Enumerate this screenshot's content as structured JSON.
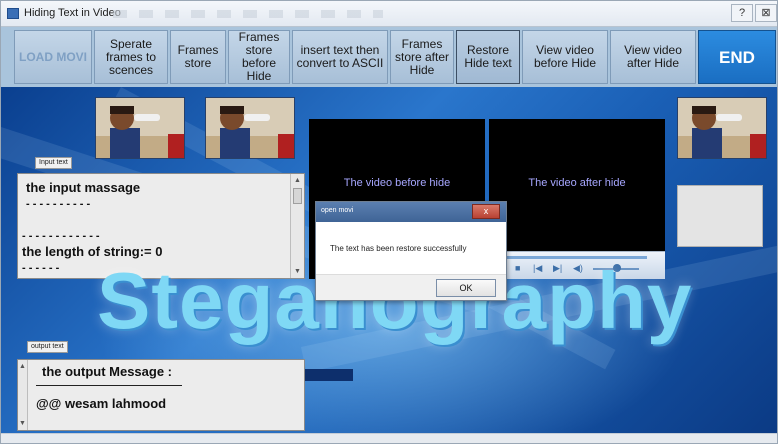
{
  "window": {
    "title": "Hiding Text in Video",
    "controls": {
      "help": "?",
      "close": "⊠"
    }
  },
  "toolbar": {
    "buttons": [
      {
        "label": "LOAD MOVI",
        "state": "disabled"
      },
      {
        "label": "Sperate frames to scences"
      },
      {
        "label": "Frames store"
      },
      {
        "label": "Frames store before Hide"
      },
      {
        "label": "insert text then convert to ASCII"
      },
      {
        "label": "Frames store after Hide"
      },
      {
        "label": "Restore Hide text",
        "state": "pressed"
      },
      {
        "label": "View video before Hide"
      },
      {
        "label": "View video after Hide"
      },
      {
        "label": "END"
      }
    ]
  },
  "input_panel": {
    "label": "Input text",
    "heading": "the input massage",
    "dashes_1": "- - - - - - - - - -",
    "dashes_2": "- - - - - - - - - - - -",
    "length_line": "the length of string:= 0",
    "dashes_3": "- - - - - -"
  },
  "output_panel": {
    "label": "output text",
    "heading": "the output Message :",
    "value": "@@ wesam lahmood"
  },
  "videos": {
    "before_caption": "The video before hide",
    "after_caption": "The video after hide"
  },
  "banner": {
    "text": "Steganography"
  },
  "dialog": {
    "title": "open movi",
    "close_label": "x",
    "message": "The text has been restore successfully",
    "ok_label": "OK"
  },
  "colors": {
    "background": "#1a5fb5",
    "end_button": "#1a6ec2",
    "banner_text": "#7fd8f5"
  }
}
